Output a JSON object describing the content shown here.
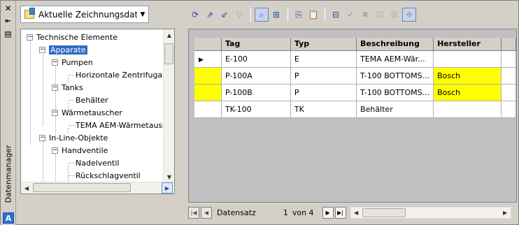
{
  "palette": {
    "title": "Datenmanager",
    "logo_letter": "A"
  },
  "combo": {
    "value": "Aktuelle Zeichnungsdaten"
  },
  "tree": {
    "nodes": [
      {
        "label": "Technische Elemente"
      },
      {
        "label": "Apparate"
      },
      {
        "label": "Pumpen"
      },
      {
        "label": "Horizontale Zentrifugalpun"
      },
      {
        "label": "Tanks"
      },
      {
        "label": "Behälter"
      },
      {
        "label": "Wärmetauscher"
      },
      {
        "label": "TEMA AEM-Wärmetausche"
      },
      {
        "label": "In-Line-Objekte"
      },
      {
        "label": "Handventile"
      },
      {
        "label": "Nadelventil"
      },
      {
        "label": "Rückschlagventil"
      }
    ]
  },
  "grid": {
    "columns": [
      "Tag",
      "Typ",
      "Beschreibung",
      "Hersteller"
    ],
    "rows": [
      {
        "tag": "E-100",
        "typ": "E",
        "beschreibung": "TEMA AEM-Wär...",
        "hersteller": ""
      },
      {
        "tag": "P-100A",
        "typ": "P",
        "beschreibung": "T-100 BOTTOMS...",
        "hersteller": "Bosch"
      },
      {
        "tag": "P-100B",
        "typ": "P",
        "beschreibung": "T-100 BOTTOMS...",
        "hersteller": "Bosch"
      },
      {
        "tag": "TK-100",
        "typ": "TK",
        "beschreibung": "Behälter",
        "hersteller": ""
      }
    ],
    "highlight_color": "#ffff00"
  },
  "navigator": {
    "label": "Datensatz",
    "current": "1",
    "total_text": "von 4"
  }
}
